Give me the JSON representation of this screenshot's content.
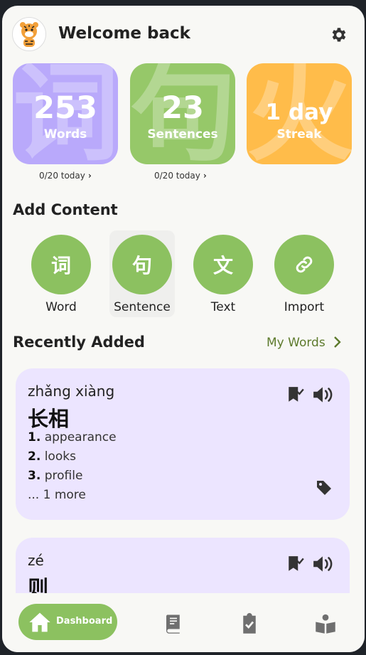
{
  "header": {
    "title": "Welcome back"
  },
  "stats": [
    {
      "value": "253",
      "label": "Words",
      "bg_char": "词",
      "color": "#b9a9fb",
      "sub": "0/20 today"
    },
    {
      "value": "23",
      "label": "Sentences",
      "bg_char": "句",
      "color": "#96c869",
      "sub": "0/20 today"
    },
    {
      "value": "1 day",
      "label": "Streak",
      "bg_char": "火",
      "color": "#ffbc4a"
    }
  ],
  "add_content": {
    "title": "Add Content",
    "items": [
      {
        "char": "词",
        "label": "Word"
      },
      {
        "char": "句",
        "label": "Sentence"
      },
      {
        "char": "文",
        "label": "Text"
      },
      {
        "icon": "link-icon",
        "label": "Import"
      }
    ]
  },
  "recent": {
    "title": "Recently Added",
    "link": "My Words",
    "cards": [
      {
        "pinyin": "zhǎng xiàng",
        "hanzi": "长相",
        "defs": [
          {
            "n": "1.",
            "t": "appearance"
          },
          {
            "n": "2.",
            "t": "looks"
          },
          {
            "n": "3.",
            "t": "profile"
          }
        ],
        "more": "... 1 more"
      },
      {
        "pinyin": "zé",
        "hanzi": "则"
      }
    ]
  },
  "nav": {
    "active_label": "Dashboard",
    "icons": [
      "home-icon",
      "book-icon",
      "clipboard-check-icon",
      "reader-icon"
    ]
  },
  "colors": {
    "accent": "#8cc160",
    "card_bg": "#ece5ff",
    "link": "#5d7a2c"
  }
}
